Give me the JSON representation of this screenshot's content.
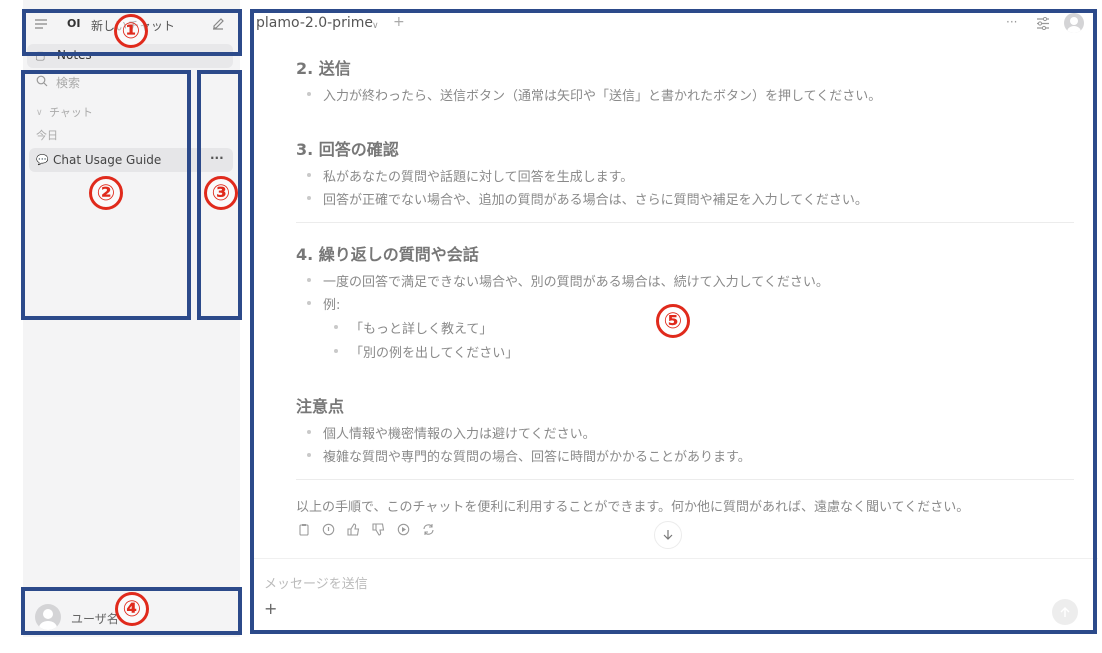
{
  "sidebar": {
    "logo": "OI",
    "new_chat": "新しいチャット",
    "notes": "Notes",
    "search": "検索",
    "chats_label": "チャット",
    "today_label": "今日",
    "chat_item": "Chat Usage Guide",
    "chat_more": "···",
    "username": "ユーザ名"
  },
  "header": {
    "model": "plamo-2.0-prime",
    "add": "+",
    "more": "···"
  },
  "content": {
    "s2_title": "2. 送信",
    "s2_items": [
      "入力が終わったら、送信ボタン（通常は矢印や「送信」と書かれたボタン）を押してください。"
    ],
    "s3_title": "3. 回答の確認",
    "s3_items": [
      "私があなたの質問や話題に対して回答を生成します。",
      "回答が正確でない場合や、追加の質問がある場合は、さらに質問や補足を入力してください。"
    ],
    "s4_title": "4. 繰り返しの質問や会話",
    "s4_items": [
      "一度の回答で満足できない場合や、別の質問がある場合は、続けて入力してください。",
      "例:"
    ],
    "s4_sub": [
      "「もっと詳しく教えて」",
      "「別の例を出してください」"
    ],
    "notes_title": "注意点",
    "notes_items": [
      "個人情報や機密情報の入力は避けてください。",
      "複雑な質問や専門的な質問の場合、回答に時間がかかることがあります。"
    ],
    "closing": "以上の手順で、このチャットを便利に利用することができます。何か他に質問があれば、遠慮なく聞いてください。"
  },
  "composer": {
    "placeholder": "メッセージを送信",
    "plus": "+"
  },
  "annotations": [
    "①",
    "②",
    "③",
    "④",
    "⑤"
  ],
  "colors": {
    "annotation_box": "#2c4a8a",
    "annotation_number": "#e02a1c"
  }
}
